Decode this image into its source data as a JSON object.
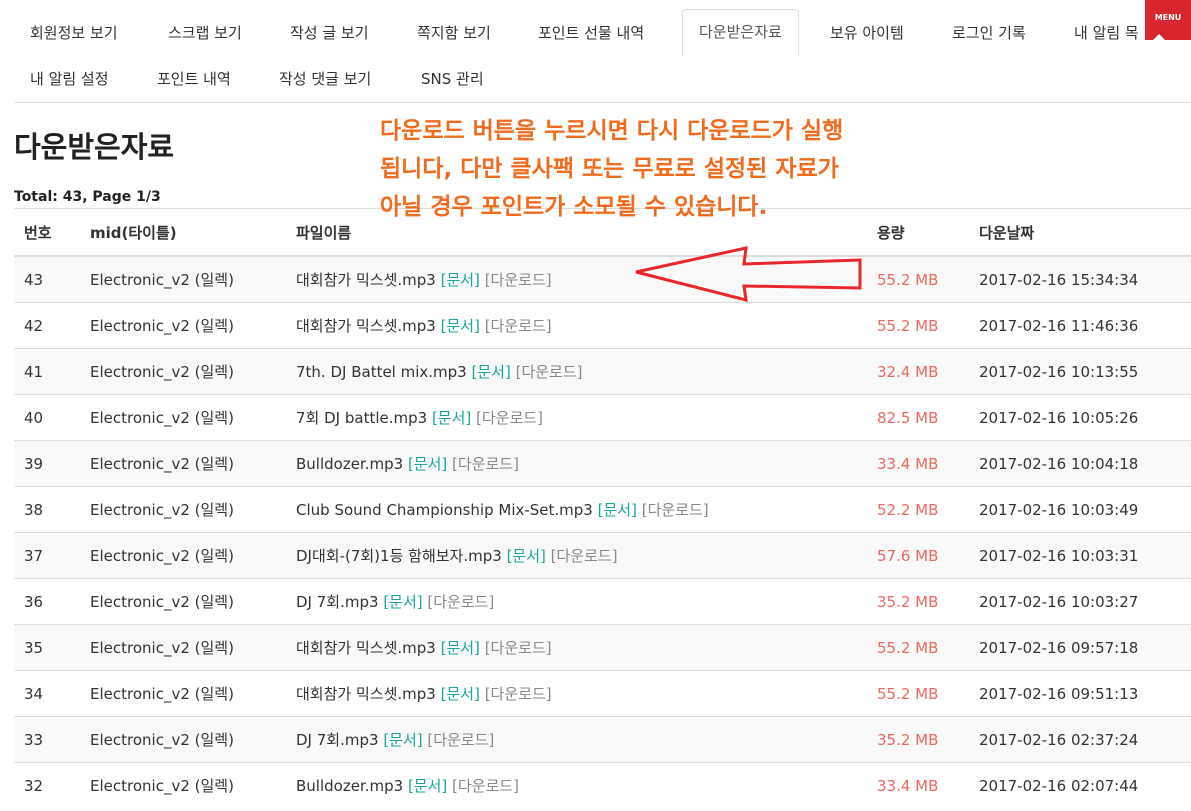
{
  "nav": {
    "tabs": [
      "회원정보 보기",
      "스크랩 보기",
      "작성 글 보기",
      "쪽지함 보기",
      "포인트 선물 내역",
      "다운받은자료",
      "보유 아이템",
      "로그인 기록",
      "내 알림 목",
      "내 알림 설정",
      "포인트 내역",
      "작성 댓글 보기",
      "SNS 관리"
    ],
    "active_index": 5,
    "menu_label": "MENU"
  },
  "page": {
    "title": "다운받은자료",
    "total": "Total: 43, Page 1/3"
  },
  "notice": {
    "line1": "다운로드 버튼을 누르시면 다시 다운로드가 실행",
    "line2": "됩니다, 다만 클사팩 또는 무료로 설정된 자료가",
    "line3": "아닐 경우 포인트가 소모될 수 있습니다."
  },
  "table": {
    "headers": {
      "no": "번호",
      "mid": "mid(타이틀)",
      "file": "파일이름",
      "size": "용량",
      "date": "다운날짜"
    },
    "doc_label": "[문서]",
    "dl_label": "[다운로드]",
    "rows": [
      {
        "no": "43",
        "mid": "Electronic_v2 (일렉)",
        "file": "대회참가 믹스셋.mp3",
        "size": "55.2 MB",
        "date": "2017-02-16 15:34:34"
      },
      {
        "no": "42",
        "mid": "Electronic_v2 (일렉)",
        "file": "대회참가 믹스셋.mp3",
        "size": "55.2 MB",
        "date": "2017-02-16 11:46:36"
      },
      {
        "no": "41",
        "mid": "Electronic_v2 (일렉)",
        "file": "7th. DJ Battel mix.mp3",
        "size": "32.4 MB",
        "date": "2017-02-16 10:13:55"
      },
      {
        "no": "40",
        "mid": "Electronic_v2 (일렉)",
        "file": "7회 DJ battle.mp3",
        "size": "82.5 MB",
        "date": "2017-02-16 10:05:26"
      },
      {
        "no": "39",
        "mid": "Electronic_v2 (일렉)",
        "file": "Bulldozer.mp3",
        "size": "33.4 MB",
        "date": "2017-02-16 10:04:18"
      },
      {
        "no": "38",
        "mid": "Electronic_v2 (일렉)",
        "file": "Club Sound Championship Mix-Set.mp3",
        "size": "52.2 MB",
        "date": "2017-02-16 10:03:49"
      },
      {
        "no": "37",
        "mid": "Electronic_v2 (일렉)",
        "file": "DJ대회-(7회)1등 함해보자.mp3",
        "size": "57.6 MB",
        "date": "2017-02-16 10:03:31"
      },
      {
        "no": "36",
        "mid": "Electronic_v2 (일렉)",
        "file": "DJ 7회.mp3",
        "size": "35.2 MB",
        "date": "2017-02-16 10:03:27"
      },
      {
        "no": "35",
        "mid": "Electronic_v2 (일렉)",
        "file": "대회참가 믹스셋.mp3",
        "size": "55.2 MB",
        "date": "2017-02-16 09:57:18"
      },
      {
        "no": "34",
        "mid": "Electronic_v2 (일렉)",
        "file": "대회참가 믹스셋.mp3",
        "size": "55.2 MB",
        "date": "2017-02-16 09:51:13"
      },
      {
        "no": "33",
        "mid": "Electronic_v2 (일렉)",
        "file": "DJ 7회.mp3",
        "size": "35.2 MB",
        "date": "2017-02-16 02:37:24"
      },
      {
        "no": "32",
        "mid": "Electronic_v2 (일렉)",
        "file": "Bulldozer.mp3",
        "size": "33.4 MB",
        "date": "2017-02-16 02:07:44"
      }
    ]
  },
  "colors": {
    "notice": "#f06b1e",
    "arrow": "#e8272c",
    "size": "#e96a5f",
    "doc": "#1aa59a",
    "menu": "#d9262e"
  }
}
